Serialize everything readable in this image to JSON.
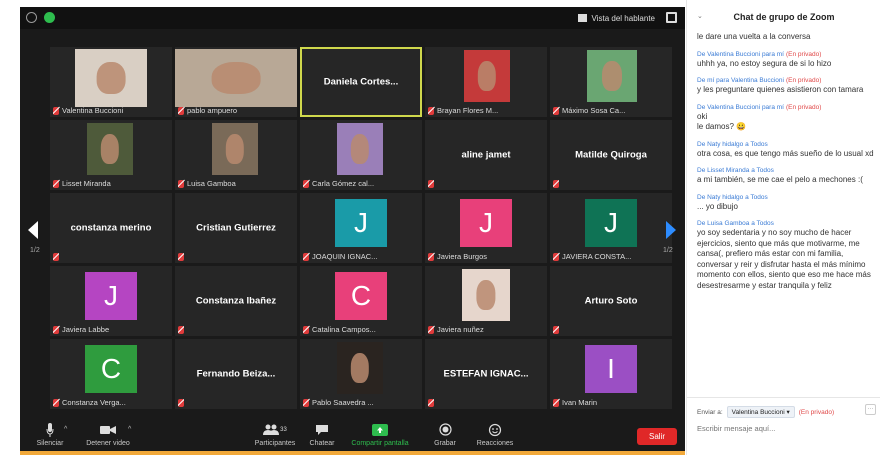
{
  "window": {
    "speaker_view_label": "Vista del hablante"
  },
  "grid": {
    "page_left": "1/2",
    "page_right": "1/2",
    "tiles": [
      {
        "name": "Valentina Buccioni",
        "type": "video",
        "bg": "#d9cfc4"
      },
      {
        "name": "pablo ampuero",
        "type": "video",
        "bg": "#b8a896"
      },
      {
        "name": "Daniela Cortes...",
        "type": "name",
        "speaking": true
      },
      {
        "name": "Brayan Flores M...",
        "type": "video",
        "bg": "#c43a3a"
      },
      {
        "name": "Máximo Sosa Ca...",
        "type": "video",
        "bg": "#6aa672"
      },
      {
        "name": "Lisset Miranda",
        "type": "video",
        "bg": "#4e5a3a"
      },
      {
        "name": "Luisa Gamboa",
        "type": "video",
        "bg": "#7a6a58"
      },
      {
        "name": "Carla Gómez cal...",
        "type": "video",
        "bg": "#9a7fb8"
      },
      {
        "name": "aline jamet",
        "type": "name"
      },
      {
        "name": "Matilde Quiroga",
        "type": "name"
      },
      {
        "name": "constanza merino",
        "type": "name"
      },
      {
        "name": "Cristian Gutierrez",
        "type": "name"
      },
      {
        "name": "JOAQUIN IGNAC...",
        "type": "avatar",
        "letter": "J",
        "color": "#1a9ba8"
      },
      {
        "name": "Javiera Burgos",
        "type": "avatar",
        "letter": "J",
        "color": "#e8407a"
      },
      {
        "name": "JAVIERA CONSTA...",
        "type": "avatar",
        "letter": "J",
        "color": "#0f7355"
      },
      {
        "name": "Javiera Labbe",
        "type": "avatar",
        "letter": "J",
        "color": "#b545c2"
      },
      {
        "name": "Constanza Ibañez",
        "type": "name"
      },
      {
        "name": "Catalina Campos...",
        "type": "avatar",
        "letter": "C",
        "color": "#e8407a"
      },
      {
        "name": "Javiera nuñez",
        "type": "video",
        "bg": "#e6d6cc"
      },
      {
        "name": "Arturo Soto",
        "type": "name"
      },
      {
        "name": "Constanza Verga...",
        "type": "avatar",
        "letter": "C",
        "color": "#2f9c3e"
      },
      {
        "name": "Fernando Beiza...",
        "type": "name"
      },
      {
        "name": "Pablo Saavedra ...",
        "type": "video",
        "bg": "#2a2420"
      },
      {
        "name": "ESTEFAN IGNAC...",
        "type": "name"
      },
      {
        "name": "Ivan Marin",
        "type": "avatar",
        "letter": "I",
        "color": "#9b4fc4"
      }
    ]
  },
  "toolbar": {
    "mute_label": "Silenciar",
    "video_label": "Detener video",
    "participants_label": "Participantes",
    "participants_count": "33",
    "chat_label": "Chatear",
    "share_label": "Compartir pantalla",
    "record_label": "Grabar",
    "reactions_label": "Reacciones",
    "leave_label": "Salir",
    "share_color": "#2ebd4e"
  },
  "chat": {
    "title": "Chat de grupo de Zoom",
    "messages": [
      {
        "meta_from": "",
        "meta_to": "",
        "meta_private": "",
        "text": "le dare una vuelta a la conversa"
      },
      {
        "meta_from": "De Valentina Buccioni",
        "meta_to": "para mí",
        "meta_private": "(En privado)",
        "text": "uhhh ya, no estoy segura de si lo hizo"
      },
      {
        "meta_from": "De mí",
        "meta_to": "para Valentina Buccioni",
        "meta_private": "(En privado)",
        "text": "y les preguntare quienes asistieron con tamara"
      },
      {
        "meta_from": "De Valentina Buccioni",
        "meta_to": "para mí",
        "meta_private": "(En privado)",
        "text": "oki\nle damos? 😀"
      },
      {
        "meta_from": "De Naty hidalgo",
        "meta_to": "a Todos",
        "meta_private": "",
        "text": "otra cosa, es que tengo más sueño de lo usual xd"
      },
      {
        "meta_from": "De Lisset Miranda",
        "meta_to": "a Todos",
        "meta_private": "",
        "text": "a mi también, se me cae el pelo a mechones :("
      },
      {
        "meta_from": "De Naty hidalgo",
        "meta_to": "a Todos",
        "meta_private": "",
        "text": "... yo dibujo"
      },
      {
        "meta_from": "De Luisa Gamboa",
        "meta_to": "a Todos",
        "meta_private": "",
        "text": "yo soy sedentaria y no soy mucho de hacer ejercicios, siento que más que motivarme, me cansa(, prefiero más estar con mi familia, conversar y reir y disfrutar hasta el más mínimo momento con ellos, siento que eso me hace más desestresarme y estar tranquila y feliz"
      }
    ],
    "send_to_label": "Enviar a:",
    "recipient": "Valentina Buccioni",
    "private_label": "(En privado)",
    "input_placeholder": "Escribir mensaje aquí..."
  }
}
